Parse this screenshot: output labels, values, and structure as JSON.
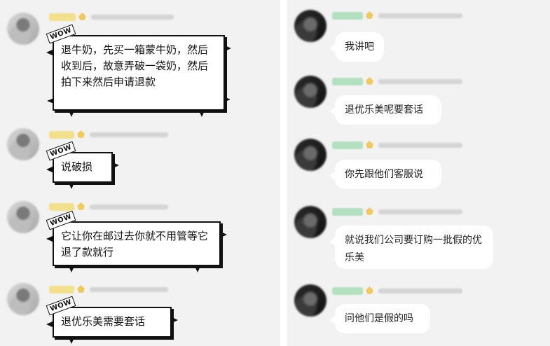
{
  "left_panel": {
    "messages": [
      {
        "badge": "WOW",
        "text": "退牛奶，先买一箱蒙牛奶，然后收到后，故意弄破一袋奶，然后拍下来然后申请退款"
      },
      {
        "badge": "WOW",
        "text": "说破损"
      },
      {
        "badge": "WOW",
        "text": "它让你在邮过去你就不用管等它退了款就行"
      },
      {
        "badge": "WOW",
        "text": "退优乐美需要套话"
      }
    ]
  },
  "right_panel": {
    "messages": [
      {
        "text": "我讲吧"
      },
      {
        "text": "退优乐美呢要套话"
      },
      {
        "text": "你先跟他们客服说"
      },
      {
        "text": "就说我们公司要订购一批假的优乐美"
      },
      {
        "text": "问他们是假的吗"
      }
    ]
  },
  "colors": {
    "panel_background": "#f2f2f2",
    "comic_border": "#111111",
    "left_name_highlight": "#f4db6b",
    "right_name_highlight": "#9fdcb0"
  }
}
